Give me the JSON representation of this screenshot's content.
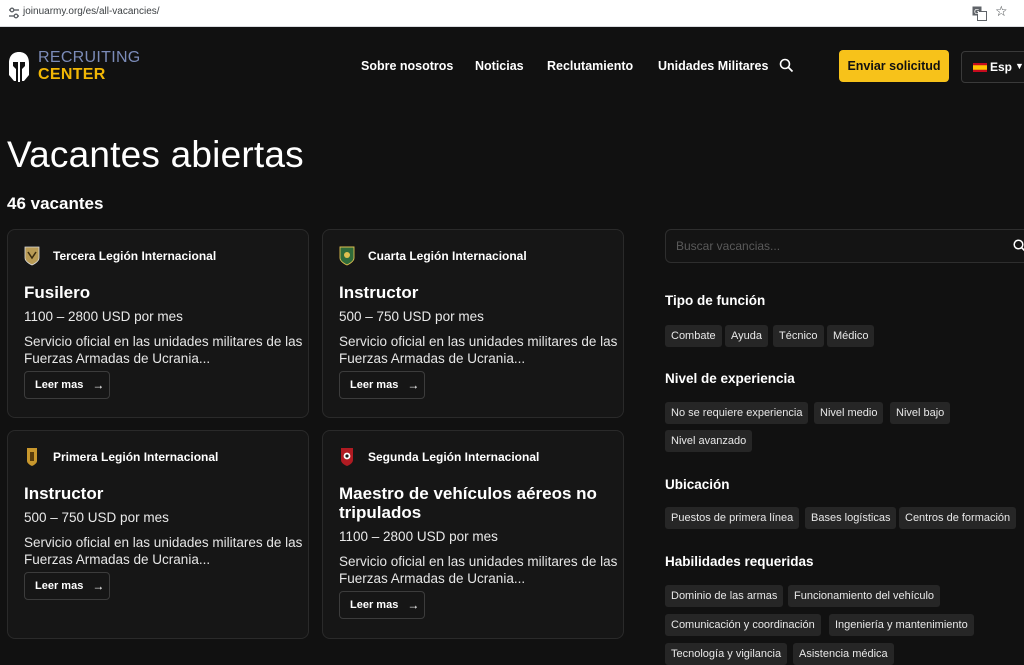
{
  "browser": {
    "url": "joinuarmy.org/es/all-vacancies/"
  },
  "header": {
    "logo_line1": "RECRUITING",
    "logo_line2": "CENTER",
    "nav": [
      "Sobre nosotros",
      "Noticias",
      "Reclutamiento",
      "Unidades Militares"
    ],
    "cta": "Enviar solicitud",
    "language": "Esp"
  },
  "main": {
    "title": "Vacantes abiertas",
    "count": "46 vacantes"
  },
  "cards": [
    {
      "legion": "Tercera Legión Internacional",
      "role": "Fusilero",
      "salary": "1100 – 2800 USD por mes",
      "description": "Servicio oficial en las unidades militares de las Fuerzas Armadas de Ucrania...",
      "button": "Leer mas"
    },
    {
      "legion": "Cuarta Legión Internacional",
      "role": "Instructor",
      "salary": "500 – 750 USD por mes",
      "description": "Servicio oficial en las unidades militares de las Fuerzas Armadas de Ucrania...",
      "button": "Leer mas"
    },
    {
      "legion": "Primera Legión Internacional",
      "role": "Instructor",
      "salary": "500 – 750 USD por mes",
      "description": "Servicio oficial en las unidades militares de las Fuerzas Armadas de Ucrania...",
      "button": "Leer mas"
    },
    {
      "legion": "Segunda Legión Internacional",
      "role": "Maestro de vehículos aéreos no tripulados",
      "salary": "1100 – 2800 USD por mes",
      "description": "Servicio oficial en las unidades militares de las Fuerzas Armadas de Ucrania...",
      "button": "Leer mas"
    }
  ],
  "sidebar": {
    "search_placeholder": "Buscar vacancias...",
    "groups": [
      {
        "title": "Tipo de función",
        "chips": [
          "Combate",
          "Ayuda",
          "Técnico",
          "Médico"
        ]
      },
      {
        "title": "Nivel de experiencia",
        "chips": [
          "No se requiere experiencia",
          "Nivel medio",
          "Nivel bajo",
          "Nivel avanzado"
        ]
      },
      {
        "title": "Ubicación",
        "chips": [
          "Puestos de primera línea",
          "Bases logísticas",
          "Centros de formación"
        ]
      },
      {
        "title": "Habilidades requeridas",
        "chips": [
          "Dominio de las armas",
          "Funcionamiento del vehículo",
          "Comunicación y coordinación",
          "Ingeniería y mantenimiento",
          "Tecnología y vigilancia",
          "Asistencia médica"
        ]
      }
    ]
  },
  "colors": {
    "background": "#111111",
    "accent": "#f7c21a",
    "card": "#161616",
    "chip": "#262626"
  }
}
